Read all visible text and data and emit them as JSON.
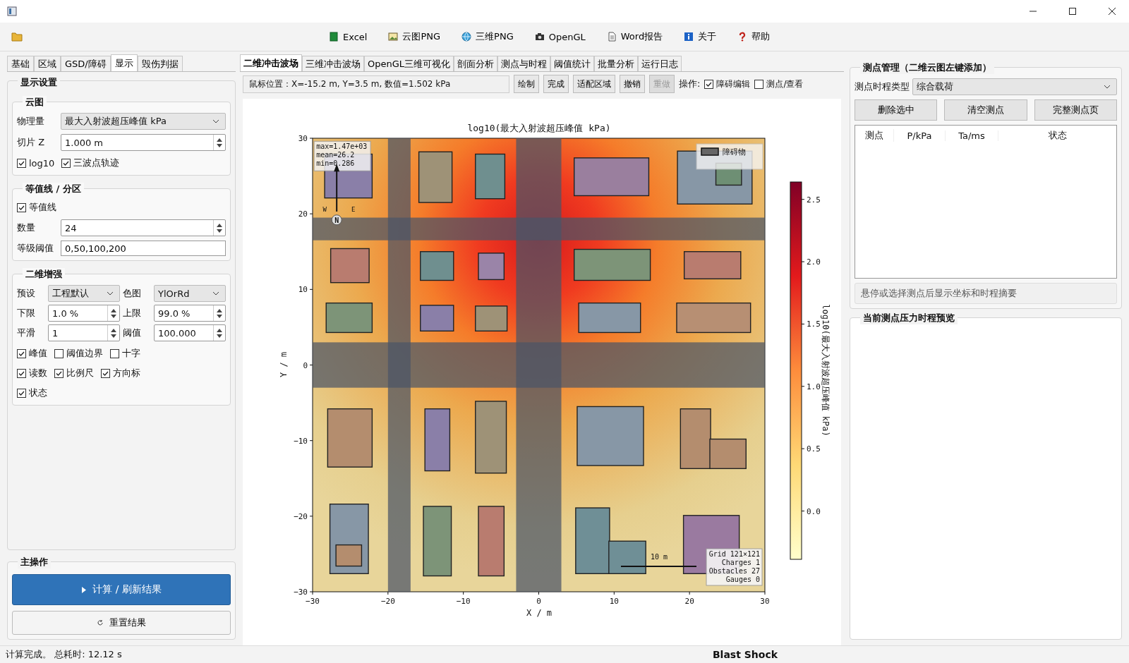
{
  "toolbar": {
    "items": [
      {
        "kind": "spreadsheet",
        "label": "Excel"
      },
      {
        "kind": "picture",
        "label": "云图PNG"
      },
      {
        "kind": "globe",
        "label": "三维PNG"
      },
      {
        "kind": "camera",
        "label": "OpenGL"
      },
      {
        "kind": "document",
        "label": "Word报告"
      },
      {
        "kind": "info",
        "label": "关于"
      },
      {
        "kind": "help",
        "label": "帮助"
      }
    ]
  },
  "left_tabs": [
    {
      "label": "基础",
      "selected": false
    },
    {
      "label": "区域",
      "selected": false
    },
    {
      "label": "GSD/障碍",
      "selected": false
    },
    {
      "label": "显示",
      "selected": true
    },
    {
      "label": "毁伤判据",
      "selected": false
    }
  ],
  "display_settings": {
    "title": "显示设置",
    "cloud": {
      "title": "云图",
      "quantity_label": "物理量",
      "quantity": "最大入射波超压峰值 kPa",
      "slice_label": "切片 Z",
      "slice": "1.000 m",
      "checks": [
        {
          "label": "log10",
          "checked": true
        },
        {
          "label": "三波点轨迹",
          "checked": true
        }
      ]
    },
    "contours": {
      "title": "等值线 / 分区",
      "checks": [
        {
          "label": "等值线",
          "checked": true
        }
      ],
      "count_label": "数量",
      "count": "24",
      "levels_label": "等级阈值",
      "levels": "0,50,100,200"
    },
    "enhance": {
      "title": "二维增强",
      "fields": [
        {
          "label": "预设",
          "value": "工程默认",
          "kind": "dropdown"
        },
        {
          "label": "色图",
          "value": "YlOrRd",
          "kind": "dropdown"
        },
        {
          "label": "下限",
          "value": "1.0 %",
          "kind": "spin"
        },
        {
          "label": "上限",
          "value": "99.0 %",
          "kind": "spin"
        },
        {
          "label": "平滑",
          "value": "1",
          "kind": "spin"
        },
        {
          "label": "阈值",
          "value": "100.000",
          "kind": "spin"
        }
      ],
      "check_rows": [
        [
          {
            "label": "峰值",
            "checked": true
          },
          {
            "label": "阈值边界",
            "checked": false
          },
          {
            "label": "十字",
            "checked": false
          }
        ],
        [
          {
            "label": "读数",
            "checked": true
          },
          {
            "label": "比例尺",
            "checked": true
          },
          {
            "label": "方向标",
            "checked": true
          }
        ],
        [
          {
            "label": "状态",
            "checked": true
          }
        ]
      ]
    }
  },
  "main_actions": {
    "title": "主操作",
    "buttons": [
      {
        "label": "计算 / 刷新结果",
        "kind": "primary"
      },
      {
        "label": "重置结果",
        "kind": "secondary"
      }
    ]
  },
  "center_tabs": [
    {
      "label": "二维冲击波场",
      "selected": true
    },
    {
      "label": "三维冲击波场",
      "selected": false
    },
    {
      "label": "OpenGL三维可视化",
      "selected": false
    },
    {
      "label": "剖面分析",
      "selected": false
    },
    {
      "label": "测点与时程",
      "selected": false
    },
    {
      "label": "阈值统计",
      "selected": false
    },
    {
      "label": "批量分析",
      "selected": false
    },
    {
      "label": "运行日志",
      "selected": false
    }
  ],
  "cursor_readout": "鼠标位置：X=-15.2 m, Y=3.5 m, 数值=1.502 kPa",
  "tool_buttons": [
    {
      "label": "绘制",
      "disabled": false
    },
    {
      "label": "完成",
      "disabled": false
    },
    {
      "label": "适配区域",
      "disabled": false
    },
    {
      "label": "撤销",
      "disabled": false
    },
    {
      "label": "重做",
      "disabled": true
    }
  ],
  "mode_label": "操作:",
  "mode_checks": [
    {
      "label": "障碍编辑",
      "checked": true
    },
    {
      "label": "测点/查看",
      "checked": false
    }
  ],
  "plot": {
    "title": "log10(最大入射波超压峰值 kPa)",
    "xlabel": "X / m",
    "ylabel": "Y / m",
    "xticks": [
      "−30",
      "−20",
      "−10",
      "0",
      "10",
      "20",
      "30"
    ],
    "yticks": [
      "30",
      "20",
      "10",
      "0",
      "−10",
      "−20",
      "−30"
    ],
    "colorbar": {
      "label": "log10(最大入射波超压峰值 kPa)",
      "ticks": [
        "2.5",
        "2.0",
        "1.5",
        "1.0",
        "0.5",
        "0.0"
      ]
    },
    "stats": [
      "max=1.47e+03",
      "mean=26.2",
      "min=0.286"
    ],
    "compass": [
      "W",
      "N",
      "E"
    ],
    "legend": [
      "障碍物"
    ],
    "scale_label": "10 m",
    "info": [
      "Grid 121×121",
      "Charges 1",
      "Obstacles 27",
      "Gauges 0"
    ]
  },
  "gauges": {
    "title": "测点管理（二维云图左键添加）",
    "type_label": "测点时程类型",
    "type": "综合载荷",
    "buttons": [
      "删除选中",
      "清空测点",
      "完整测点页"
    ],
    "columns": [
      "测点",
      "P/kPa",
      "Ta/ms",
      "状态"
    ],
    "hint": "悬停或选择测点后显示坐标和时程摘要"
  },
  "preview": {
    "title": "当前测点压力时程预览"
  },
  "status_bar": {
    "message": "计算完成。 总耗时: 12.12 s",
    "right": "Blast Shock"
  }
}
